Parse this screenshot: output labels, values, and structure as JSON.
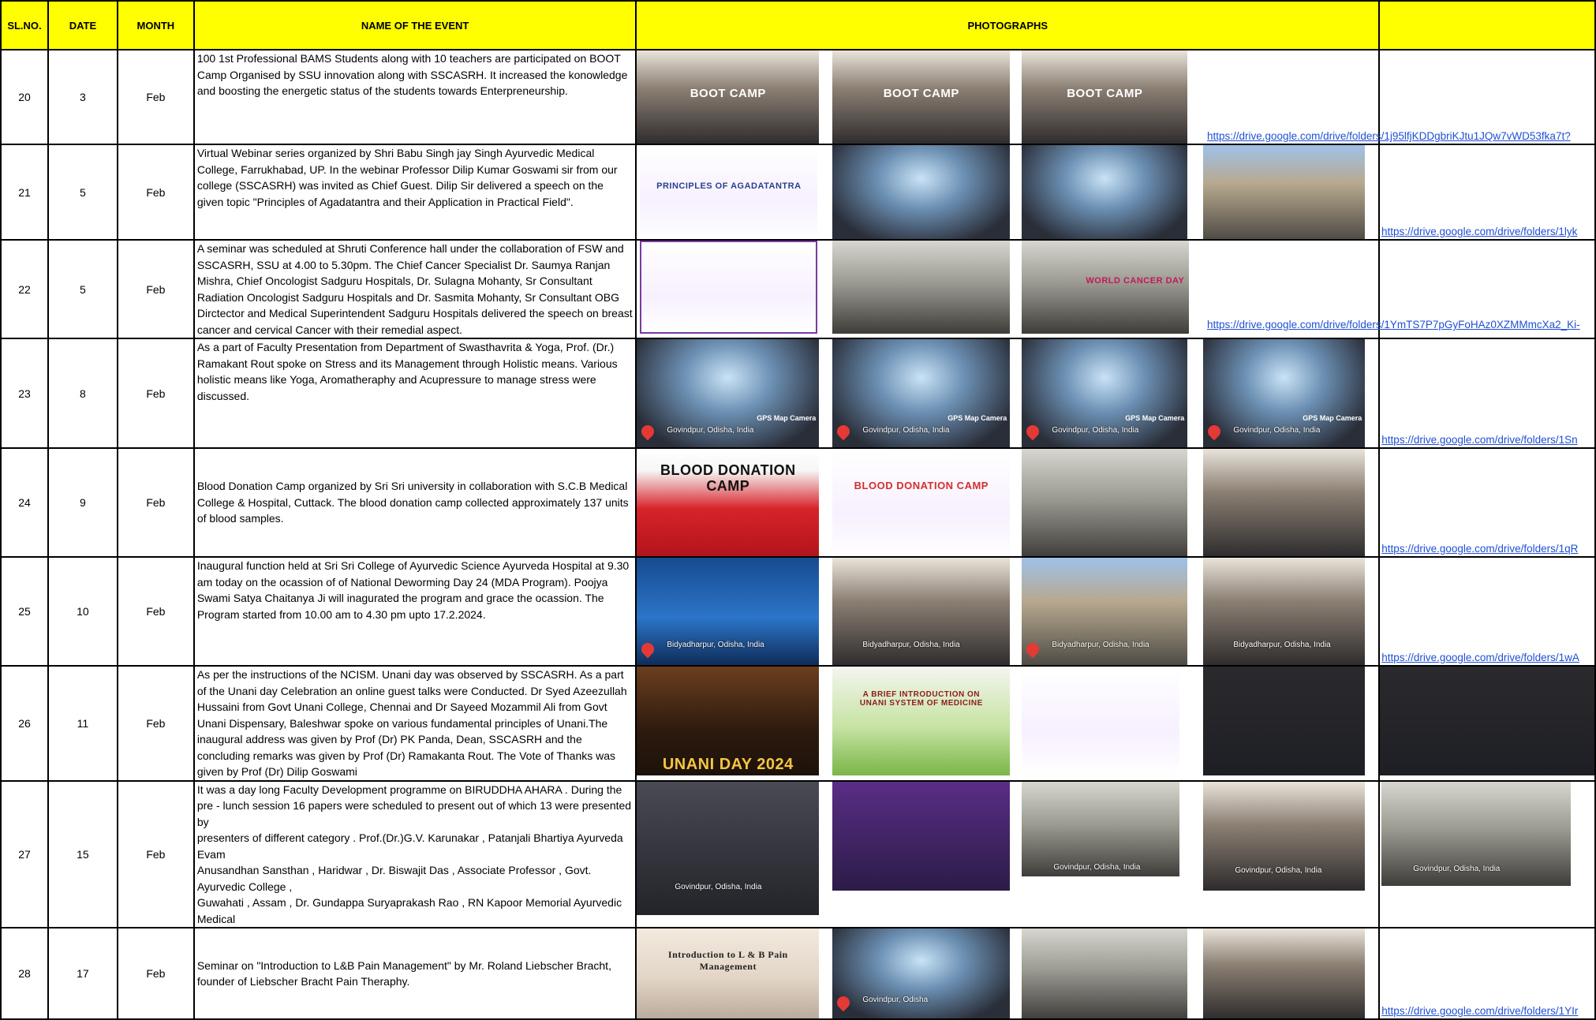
{
  "headers": {
    "slno": "SL.NO.",
    "date": "DATE",
    "month": "MONTH",
    "event": "NAME OF THE EVENT",
    "photos": "PHOTOGRAPHS"
  },
  "rows": [
    {
      "slno": "20",
      "date": "3",
      "month": "Feb",
      "event": "100 1st Professional BAMS Students along with 10 teachers are participated on BOOT Camp Organised by SSU innovation along with SSCASRH. It increased the konowledge and boosting the energetic status of the students towards Enterpreneurship.",
      "link": "https://drive.google.com/drive/folders/1j95lfjKDDgbriKJtu1JQw7vWD53fka7t?",
      "photo_titles": [
        "BOOT CAMP",
        "BOOT CAMP",
        "BOOT CAMP"
      ]
    },
    {
      "slno": "21",
      "date": "5",
      "month": "Feb",
      "event": "Virtual Webinar series organized by Shri Babu Singh jay Singh Ayurvedic Medical College, Farrukhabad, UP. In the webinar Professor Dilip Kumar Goswami sir from our college (SSCASRH) was invited as Chief Guest. Dilip Sir delivered a speech on the given topic \"Principles of Agadatantra and their Application in Practical Field\".",
      "link": "https://drive.google.com/drive/folders/1lyk",
      "photo_titles": [
        "PRINCIPLES OF AGADATANTRA",
        "",
        "",
        ""
      ]
    },
    {
      "slno": "22",
      "date": "5",
      "month": "Feb",
      "event": "A seminar was scheduled at Shruti Conference hall under the collaboration of FSW and SSCASRH, SSU at 4.00 to 5.30pm. The Chief Cancer Specialist Dr. Saumya Ranjan Mishra, Chief Oncologist Sadguru Hospitals, Dr. Sulagna Mohanty, Sr Consultant Radiation Oncologist Sadguru Hospitals and Dr. Sasmita Mohanty, Sr Consultant OBG Dirctector and Medical Superintendent Sadguru Hospitals delivered the speech on breast cancer and cervical Cancer with their remedial aspect.",
      "link": "https://drive.google.com/drive/folders/1YmTS7P7pGyFoHAz0XZMMmcXa2_Ki-",
      "photo_titles": [
        "WORLD CANCER DAY",
        "",
        "WORLD CANCER DAY"
      ]
    },
    {
      "slno": "23",
      "date": "8",
      "month": "Feb",
      "event": "As a part of Faculty Presentation from Department of Swasthavrita & Yoga, Prof. (Dr.) Ramakant Rout spoke on Stress and its Management through Holistic means. Various holistic means like Yoga, Aromatheraphy and Acupressure to manage stress were discussed.",
      "link": "https://drive.google.com/drive/folders/1Sn",
      "photo_captions": [
        "Govindpur, Odisha, India",
        "Govindpur, Odisha, India",
        "Govindpur, Odisha, India",
        "Govindpur, Odisha, India"
      ],
      "gps_label": "GPS Map Camera"
    },
    {
      "slno": "24",
      "date": "9",
      "month": "Feb",
      "event": "Blood Donation Camp organized by Sri Sri university in collaboration with S.C.B Medical College & Hospital, Cuttack. The blood donation camp collected approximately 137 units of blood samples.",
      "link": "https://drive.google.com/drive/folders/1qR",
      "photo_titles": [
        "BLOOD DONATION CAMP",
        "BLOOD DONATION CAMP",
        "",
        ""
      ]
    },
    {
      "slno": "25",
      "date": "10",
      "month": "Feb",
      "event": "Inaugural function held at Sri Sri College of Ayurvedic Science Ayurveda Hospital at 9.30 am today on the ocassion of of National Deworming Day 24 (MDA Program). Poojya Swami Satya Chaitanya Ji will inagurated the program and grace the ocassion. The Program started from 10.00 am to 4.30 pm upto 17.2.2024.",
      "link": "https://drive.google.com/drive/folders/1wA",
      "photo_captions": [
        "Bidyadharpur, Odisha, India",
        "Bidyadharpur, Odisha, India",
        "Bidyadharpur, Odisha, India",
        "Bidyadharpur, Odisha, India"
      ]
    },
    {
      "slno": "26",
      "date": "11",
      "month": "Feb",
      "event": "As per the instructions of the NCISM. Unani day was observed by SSCASRH. As a part of the Unani day Celebration  an online guest talks were Conducted. Dr Syed Azeezullah Hussaini from Govt Unani College, Chennai and Dr Sayeed Mozammil Ali from Govt Unani Dispensary, Baleshwar spoke on various fundamental principles of Unani.The inaugural address was given by Prof (Dr) PK Panda, Dean, SSCASRH and the concluding remarks was given by Prof (Dr) Ramakanta Rout. The Vote of Thanks was given by Prof (Dr) Dilip Goswami",
      "photo_titles": [
        "UNANI DAY 2024",
        "A BRIEF INTRODUCTION ON UNANI SYSTEM OF MEDICINE",
        "",
        "",
        ""
      ]
    },
    {
      "slno": "27",
      "date": "15",
      "month": "Feb",
      "event": "It was a day long Faculty Development programme on BIRUDDHA AHARA . During the pre - lunch session 16 papers were scheduled to present out of which 13 were presented by\npresenters of different category . Prof.(Dr.)G.V. Karunakar , Patanjali Bhartiya Ayurveda Evam\nAnusandhan Sansthan , Haridwar , Dr. Biswajit Das , Associate Professor , Govt. Ayurvedic College ,\nGuwahati , Assam , Dr. Gundappa Suryaprakash Rao , RN Kapoor Memorial Ayurvedic Medical",
      "photo_captions": [
        "Govindpur, Odisha, India",
        "",
        "Govindpur, Odisha, India",
        "Govindpur, Odisha, India",
        "Govindpur, Odisha, India"
      ]
    },
    {
      "slno": "28",
      "date": "17",
      "month": "Feb",
      "event": "Seminar on \"Introduction to L&B Pain Management\" by Mr. Roland Liebscher Bracht, founder of Liebscher Bracht Pain Theraphy.",
      "link": "https://drive.google.com/drive/folders/1YIr",
      "photo_titles": [
        "Introduction to L & B Pain Management",
        "",
        "",
        ""
      ],
      "photo_captions": [
        "",
        "Govindpur, Odisha",
        "",
        ""
      ]
    }
  ],
  "colors": {
    "header_bg": "#ffff00",
    "link": "#1f4fd6",
    "border": "#000000"
  }
}
